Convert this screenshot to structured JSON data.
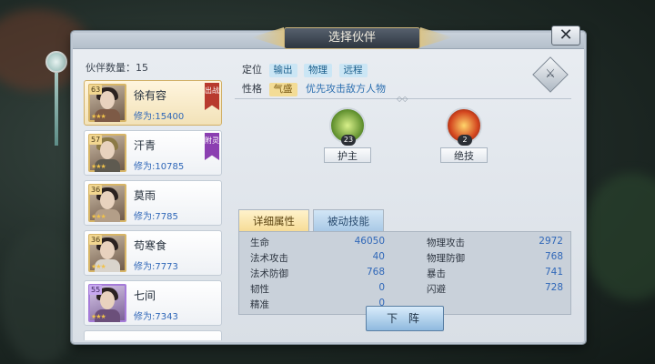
{
  "window": {
    "title": "选择伙伴",
    "close_label": "✕"
  },
  "list": {
    "count_label": "伙伴数量：",
    "count": "15",
    "items": [
      {
        "level": "63",
        "name": "徐有容",
        "power": "修为:15400",
        "stars": "★★★",
        "tag": "出战",
        "rarity": "gold",
        "selected": true
      },
      {
        "level": "57",
        "name": "汗青",
        "power": "修为:10785",
        "stars": "★★★",
        "tag": "附灵",
        "rarity": "gold",
        "selected": false
      },
      {
        "level": "36",
        "name": "莫雨",
        "power": "修为:7785",
        "stars": "★★★",
        "tag": "",
        "rarity": "gold",
        "selected": false
      },
      {
        "level": "36",
        "name": "苟寒食",
        "power": "修为:7773",
        "stars": "★★★",
        "tag": "",
        "rarity": "gold",
        "selected": false
      },
      {
        "level": "55",
        "name": "七间",
        "power": "修为:7343",
        "stars": "★★★",
        "tag": "",
        "rarity": "purple",
        "selected": false
      }
    ]
  },
  "detail": {
    "role_label": "定位",
    "roles": [
      "输出",
      "物理",
      "远程"
    ],
    "trait_label": "性格",
    "trait": "气盛",
    "trait_desc": "优先攻击敌方人物",
    "skills": [
      {
        "name": "护主",
        "level": "23",
        "icon": "leaf-shield-icon"
      },
      {
        "name": "绝技",
        "level": "2",
        "icon": "flame-icon"
      }
    ],
    "tabs": {
      "active": "详细属性",
      "inactive": "被动技能"
    },
    "stats_left": [
      {
        "label": "生命",
        "value": "46050"
      },
      {
        "label": "法术攻击",
        "value": "40"
      },
      {
        "label": "法术防御",
        "value": "768"
      },
      {
        "label": "韧性",
        "value": "0"
      },
      {
        "label": "精准",
        "value": "0"
      }
    ],
    "stats_right": [
      {
        "label": "物理攻击",
        "value": "2972"
      },
      {
        "label": "物理防御",
        "value": "768"
      },
      {
        "label": "暴击",
        "value": "741"
      },
      {
        "label": "闪避",
        "value": "728"
      }
    ],
    "deploy_label": "下 阵"
  }
}
